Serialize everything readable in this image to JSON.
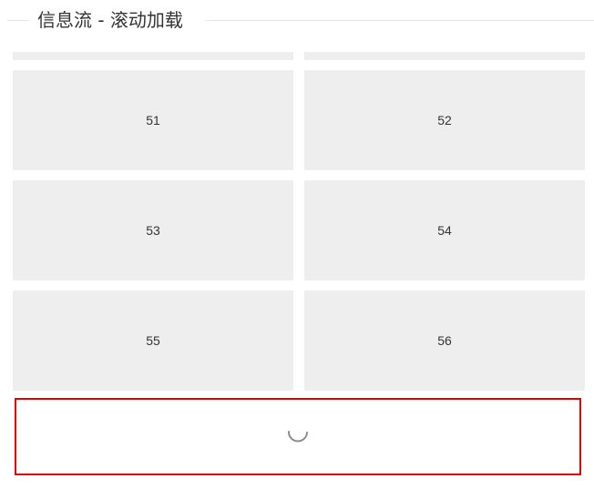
{
  "header": {
    "title": "信息流 - 滚动加载"
  },
  "flow": {
    "items": [
      {
        "label": ""
      },
      {
        "label": ""
      },
      {
        "label": "51"
      },
      {
        "label": "52"
      },
      {
        "label": "53"
      },
      {
        "label": "54"
      },
      {
        "label": "55"
      },
      {
        "label": "56"
      }
    ]
  },
  "loader": {
    "icon": "loading-spinner-icon",
    "color": "#e60000"
  }
}
